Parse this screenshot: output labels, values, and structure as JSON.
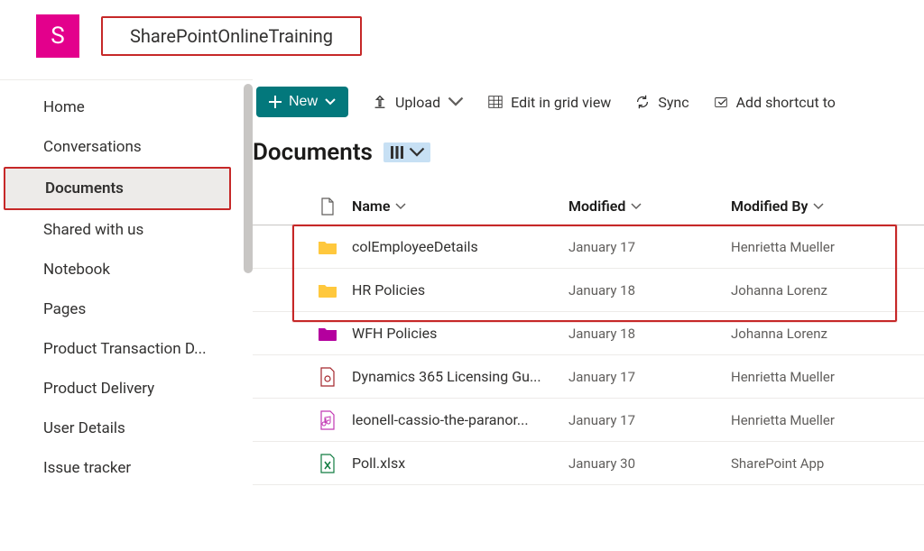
{
  "site": {
    "tile_letter": "S",
    "title": "SharePointOnlineTraining"
  },
  "sidebar": {
    "items": [
      {
        "label": "Home"
      },
      {
        "label": "Conversations"
      },
      {
        "label": "Documents",
        "selected": true
      },
      {
        "label": "Shared with us"
      },
      {
        "label": "Notebook"
      },
      {
        "label": "Pages"
      },
      {
        "label": "Product Transaction D..."
      },
      {
        "label": "Product Delivery"
      },
      {
        "label": "User Details"
      },
      {
        "label": "Issue tracker"
      }
    ]
  },
  "cmdbar": {
    "new_label": "New",
    "upload_label": "Upload",
    "edit_label": "Edit in grid view",
    "sync_label": "Sync",
    "shortcut_label": "Add shortcut to"
  },
  "library": {
    "title": "Documents"
  },
  "columns": {
    "name": "Name",
    "modified": "Modified",
    "modified_by": "Modified By"
  },
  "items": [
    {
      "icon": "folder-yellow",
      "name": "colEmployeeDetails",
      "modified": "January 17",
      "modified_by": "Henrietta Mueller"
    },
    {
      "icon": "folder-yellow",
      "name": "HR Policies",
      "modified": "January 18",
      "modified_by": "Johanna Lorenz"
    },
    {
      "icon": "folder-magenta",
      "name": "WFH Policies",
      "modified": "January 18",
      "modified_by": "Johanna Lorenz"
    },
    {
      "icon": "file-pdf",
      "name": "Dynamics 365 Licensing Gu...",
      "modified": "January 17",
      "modified_by": "Henrietta Mueller"
    },
    {
      "icon": "file-audio",
      "name": "leonell-cassio-the-paranor...",
      "modified": "January 17",
      "modified_by": "Henrietta Mueller"
    },
    {
      "icon": "file-excel",
      "name": "Poll.xlsx",
      "modified": "January 30",
      "modified_by": "SharePoint App"
    }
  ]
}
